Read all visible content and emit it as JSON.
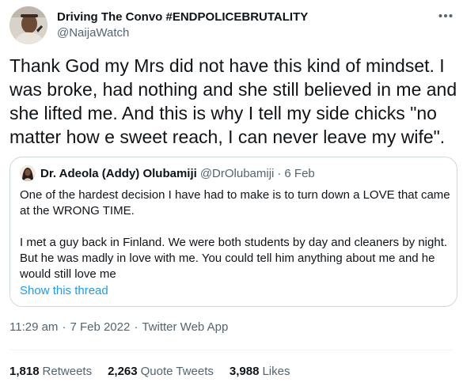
{
  "author": {
    "display_name": "Driving The Convo #ENDPOLICEBRUTALITY",
    "handle": "@NaijaWatch"
  },
  "tweet": {
    "text": "Thank God my Mrs did not have this kind of mindset. I was broke, had nothing and she still believed in me and she lifted me. And this is why I tell my side chicks \"no matter how e sweet reach, I can never leave my wife\"."
  },
  "quote": {
    "name": "Dr. Adeola (Addy) Olubamiji",
    "handle": "@DrOlubamiji",
    "separator": "·",
    "date": "6 Feb",
    "paragraph1": "One of the hardest decision I have had to make is to turn down a LOVE that came at the WRONG TIME.",
    "paragraph2": "I met a guy back in Finland. We were both students by day and cleaners by night. But he was madly in love with me. You could tell him anything about me and he would still love me",
    "show_thread": "Show this thread"
  },
  "meta": {
    "time": "11:29 am",
    "separator": "·",
    "date": "7 Feb 2022",
    "source": "Twitter Web App"
  },
  "stats": {
    "retweets_count": "1,818",
    "retweets_label": "Retweets",
    "quotes_count": "2,263",
    "quotes_label": "Quote Tweets",
    "likes_count": "3,988",
    "likes_label": "Likes"
  },
  "colors": {
    "link": "#1d9bf0",
    "secondary_text": "#536471",
    "border": "#cfd9de"
  },
  "icons": {
    "more": "more-horizontal-icon"
  }
}
